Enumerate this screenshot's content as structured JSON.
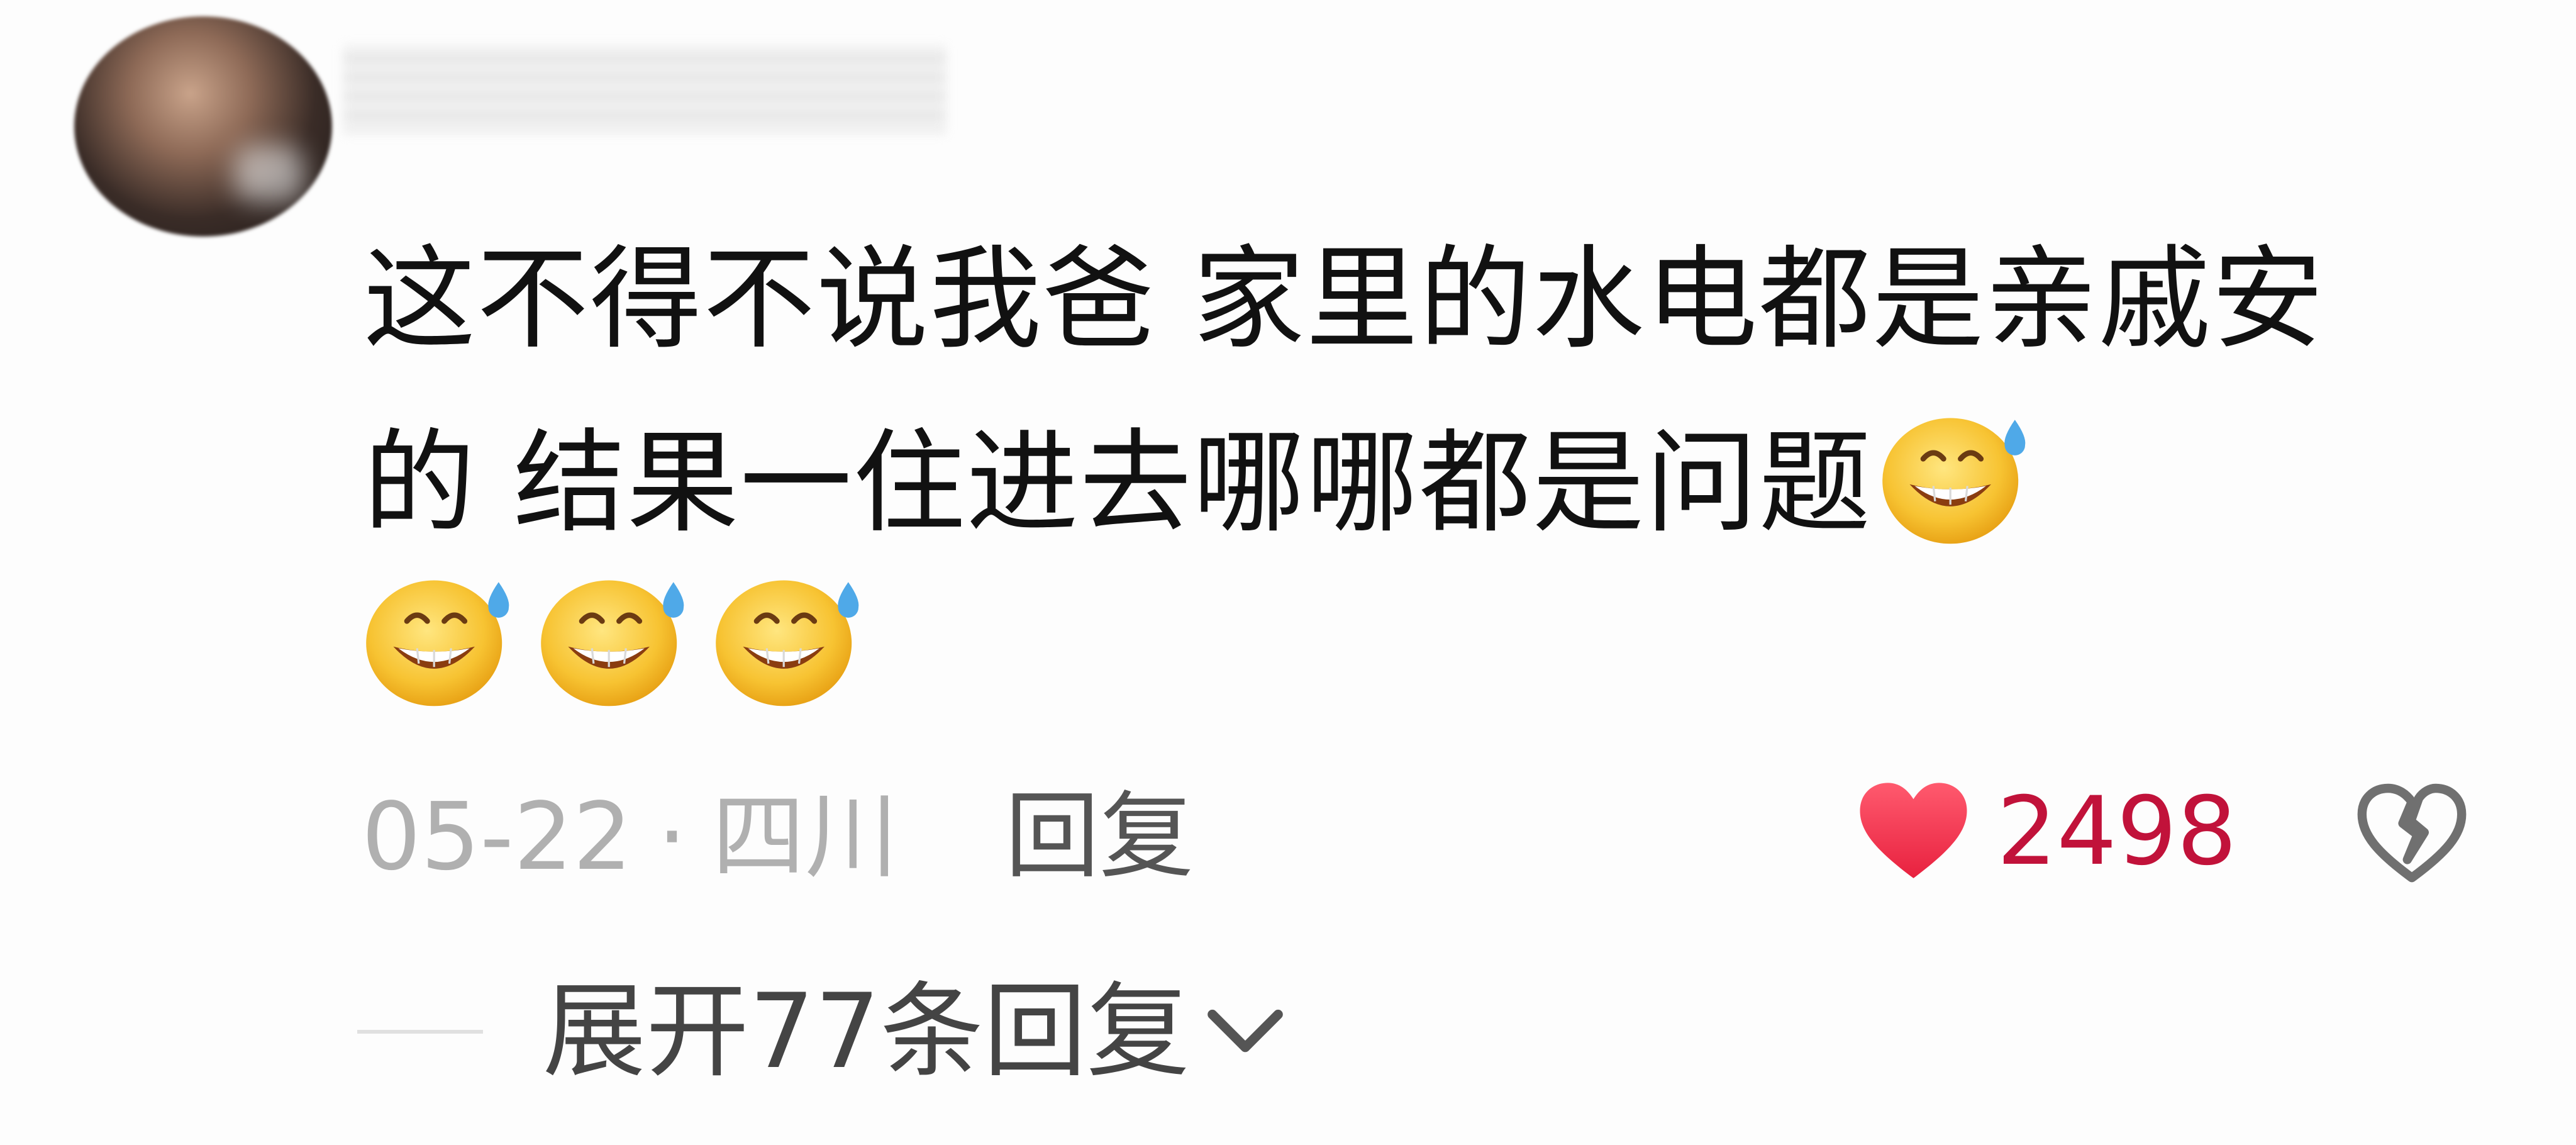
{
  "comment": {
    "text": "这不得不说我爸 家里的水电都是亲戚安的 结果一住进去哪哪都是问题",
    "inline_emoji": "grinning-sweat-emoji",
    "trailing_emoji_count": 3,
    "date": "05-22",
    "separator": "·",
    "location": "四川",
    "reply_label": "回复",
    "like_count": "2498",
    "expand_label": "展开77条回复",
    "colors": {
      "like": "#c1123a",
      "heart": "#f0344f",
      "meta": "#b0b0b0"
    }
  }
}
